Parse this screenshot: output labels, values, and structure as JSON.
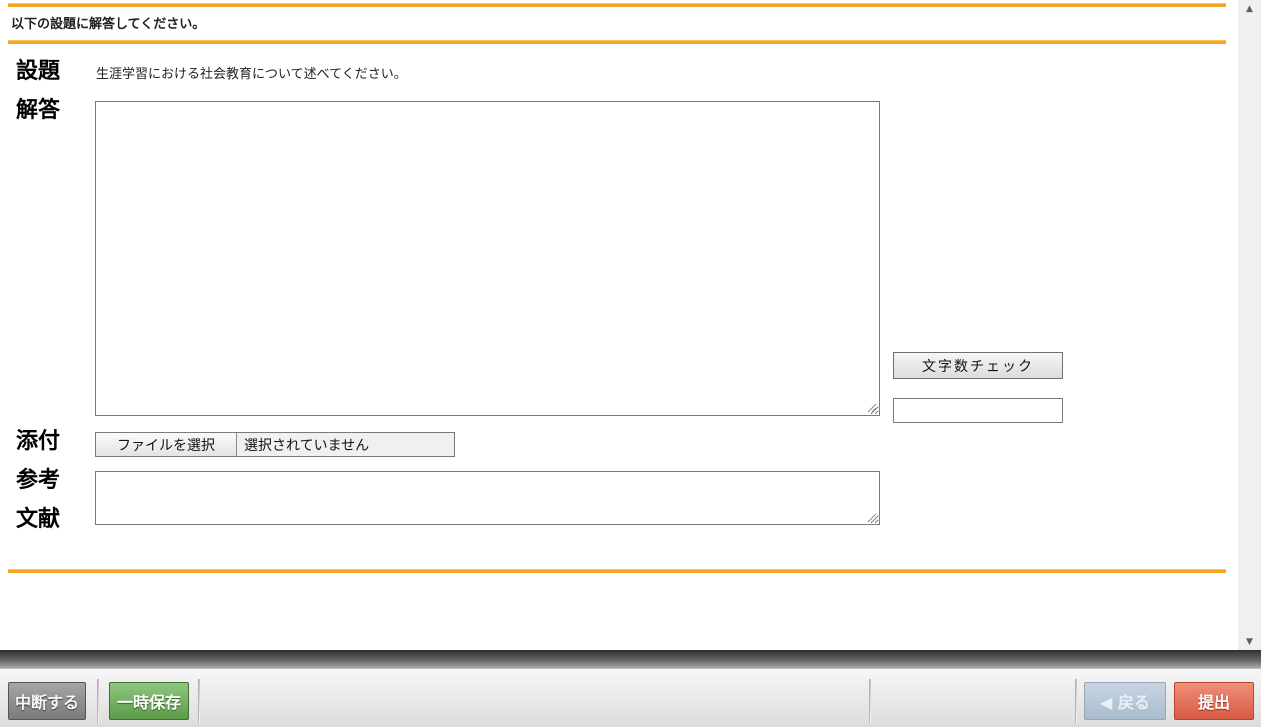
{
  "instruction": "以下の設題に解答してください。",
  "labels": {
    "question": "設題",
    "answer": "解答",
    "attachment": "添付",
    "reference_1": "参考",
    "reference_2": "文献"
  },
  "question_text": "生涯学習における社会教育について述べてください。",
  "answer": {
    "value": ""
  },
  "reference": {
    "value": ""
  },
  "char_count": {
    "button_label": "文字数チェック",
    "result": ""
  },
  "file": {
    "button_label": "ファイルを選択",
    "status": "選択されていません"
  },
  "footer": {
    "suspend_label": "中断する",
    "save_label": "一時保存",
    "back_label": "◀ 戻る",
    "submit_label": "提出"
  },
  "colors": {
    "accent_line": "#f5a623",
    "save": "#6aaa58",
    "submit": "#e06a52",
    "back": "#b8c9d9"
  },
  "icons": {
    "scroll_up": "scroll-up-icon",
    "scroll_down": "scroll-down-icon",
    "resize_grip": "resize-grip-icon"
  }
}
